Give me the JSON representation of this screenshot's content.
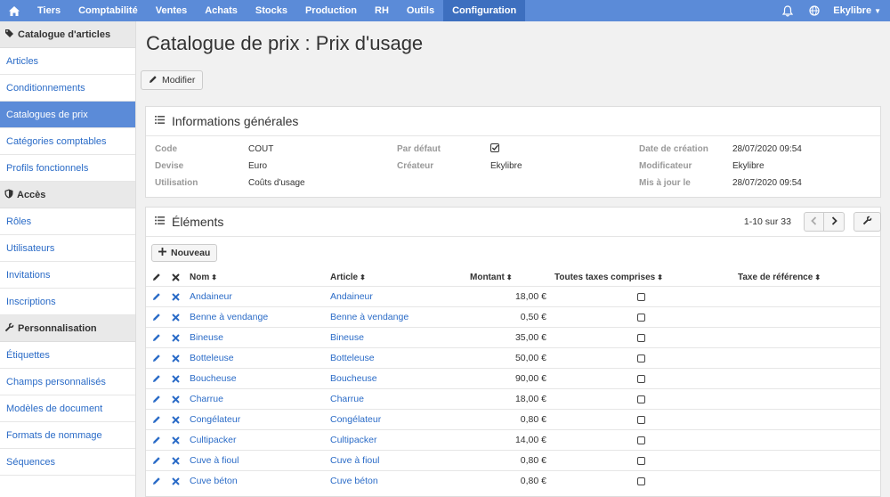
{
  "topnav": {
    "items": [
      "Tiers",
      "Comptabilité",
      "Ventes",
      "Achats",
      "Stocks",
      "Production",
      "RH",
      "Outils",
      "Configuration"
    ],
    "active": "Configuration",
    "user": "Ekylibre"
  },
  "sidebar": {
    "sections": [
      {
        "title": "Catalogue d'articles",
        "items": [
          "Articles",
          "Conditionnements",
          "Catalogues de prix",
          "Catégories comptables",
          "Profils fonctionnels"
        ]
      },
      {
        "title": "Accès",
        "items": [
          "Rôles",
          "Utilisateurs",
          "Invitations",
          "Inscriptions"
        ]
      },
      {
        "title": "Personnalisation",
        "items": [
          "Étiquettes",
          "Champs personnalisés",
          "Modèles de document",
          "Formats de nommage",
          "Séquences"
        ]
      }
    ],
    "active_item": "Catalogues de prix"
  },
  "page": {
    "title": "Catalogue de prix : Prix d'usage",
    "modify_label": "Modifier"
  },
  "info": {
    "title": "Informations générales",
    "code_label": "Code",
    "code_value": "COUT",
    "devise_label": "Devise",
    "devise_value": "Euro",
    "utilisation_label": "Utilisation",
    "utilisation_value": "Coûts d'usage",
    "par_defaut_label": "Par défaut",
    "par_defaut_checked": true,
    "createur_label": "Créateur",
    "createur_value": "Ekylibre",
    "date_creation_label": "Date de création",
    "date_creation_value": "28/07/2020 09:54",
    "modificateur_label": "Modificateur",
    "modificateur_value": "Ekylibre",
    "mis_a_jour_label": "Mis à jour le",
    "mis_a_jour_value": "28/07/2020 09:54"
  },
  "elements": {
    "title": "Éléments",
    "pager": "1-10 sur 33",
    "new_label": "Nouveau",
    "columns": {
      "nom": "Nom",
      "article": "Article",
      "montant": "Montant",
      "ttc": "Toutes taxes comprises",
      "taxe": "Taxe de référence"
    },
    "rows": [
      {
        "nom": "Andaineur",
        "article": "Andaineur",
        "montant": "18,00 €"
      },
      {
        "nom": "Benne à vendange",
        "article": "Benne à vendange",
        "montant": "0,50 €"
      },
      {
        "nom": "Bineuse",
        "article": "Bineuse",
        "montant": "35,00 €"
      },
      {
        "nom": "Botteleuse",
        "article": "Botteleuse",
        "montant": "50,00 €"
      },
      {
        "nom": "Boucheuse",
        "article": "Boucheuse",
        "montant": "90,00 €"
      },
      {
        "nom": "Charrue",
        "article": "Charrue",
        "montant": "18,00 €"
      },
      {
        "nom": "Congélateur",
        "article": "Congélateur",
        "montant": "0,80 €"
      },
      {
        "nom": "Cultipacker",
        "article": "Cultipacker",
        "montant": "14,00 €"
      },
      {
        "nom": "Cuve à fioul",
        "article": "Cuve à fioul",
        "montant": "0,80 €"
      },
      {
        "nom": "Cuve béton",
        "article": "Cuve béton",
        "montant": "0,80 €"
      }
    ]
  },
  "colors": {
    "nav": "#5b8bd8",
    "nav_active": "#3d6fbf",
    "link": "#2a6bc7"
  }
}
